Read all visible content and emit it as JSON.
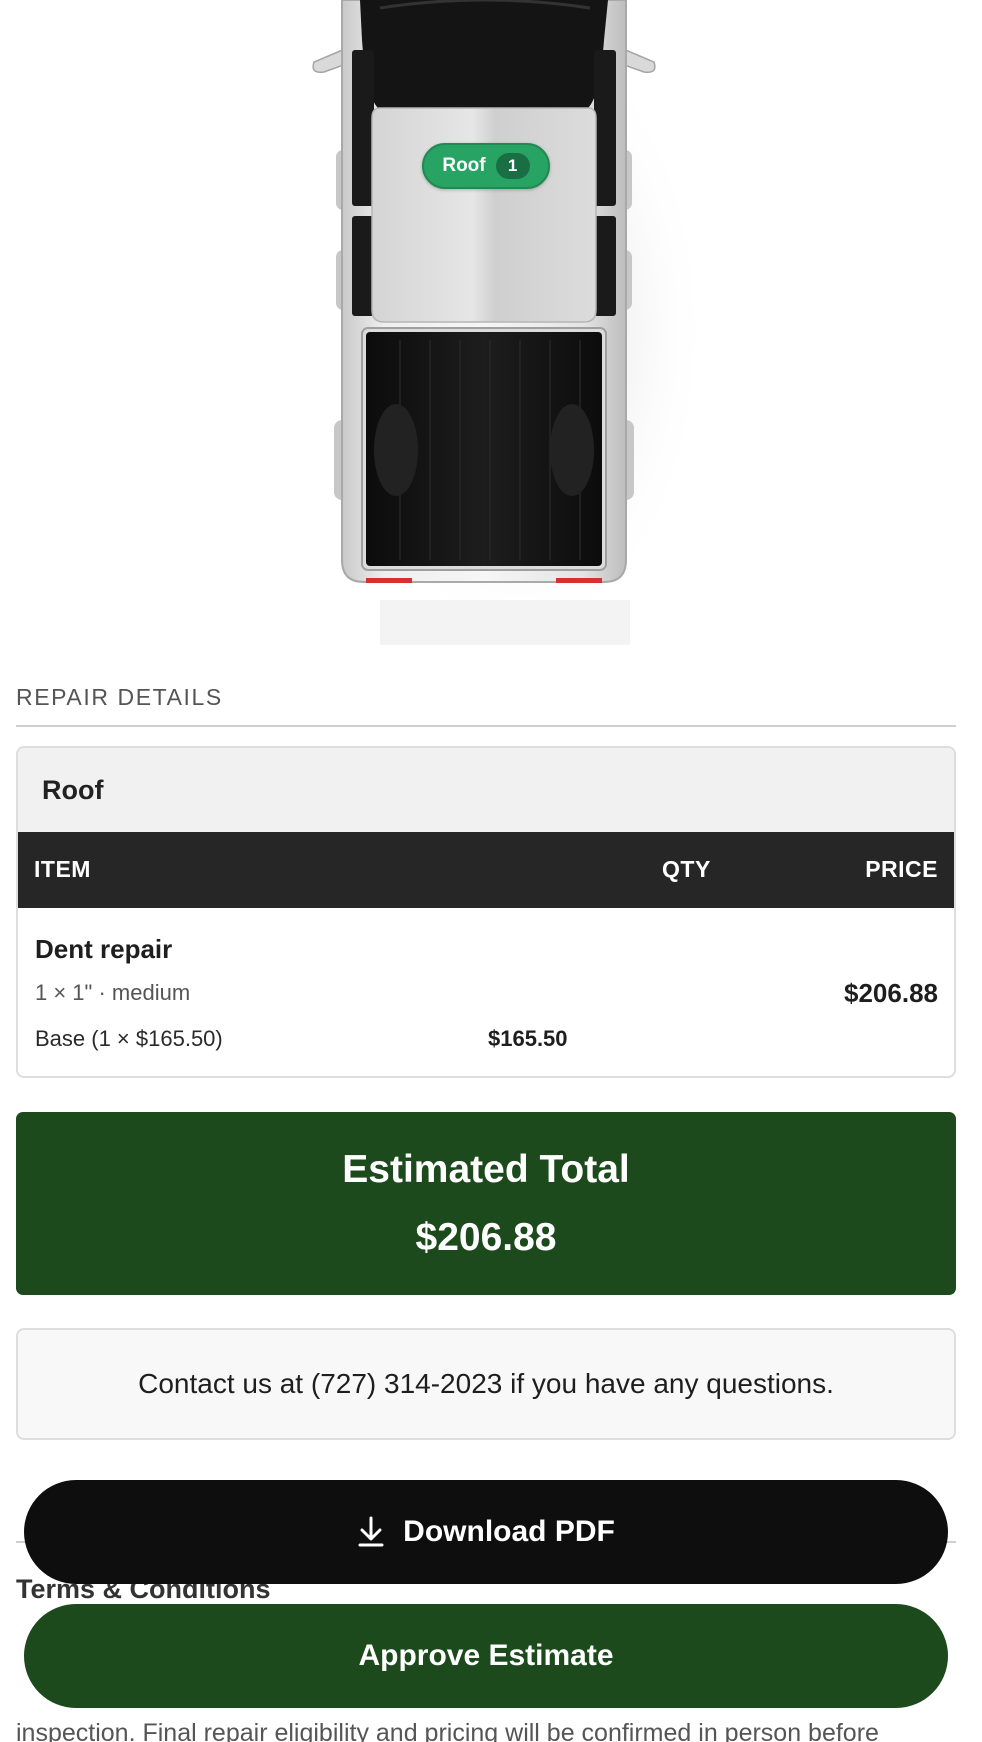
{
  "diagram": {
    "roof_badge": {
      "label": "Roof",
      "count": "1"
    }
  },
  "repair_details": {
    "heading": "REPAIR DETAILS",
    "section": {
      "title": "Roof",
      "columns": {
        "item": "ITEM",
        "qty": "QTY",
        "price": "PRICE"
      },
      "items": [
        {
          "name": "Dent repair",
          "description": "1 × 1\" · medium",
          "price": "$206.88",
          "base_label": "Base (1 × $165.50)",
          "base_value": "$165.50"
        }
      ]
    }
  },
  "total": {
    "label": "Estimated Total",
    "value": "$206.88"
  },
  "contact": {
    "text": "Contact us at (727) 314-2023 if you have any questions."
  },
  "terms": {
    "title": "Terms & Conditions",
    "visible_line": "inspection. Final repair eligibility and pricing will be confirmed in person before"
  },
  "actions": {
    "download_label": "Download PDF",
    "approve_label": "Approve Estimate"
  },
  "colors": {
    "badge_green": "#27a363",
    "total_green": "#1d4a1d",
    "table_header": "#262626",
    "download_button": "#0e0e0e"
  }
}
